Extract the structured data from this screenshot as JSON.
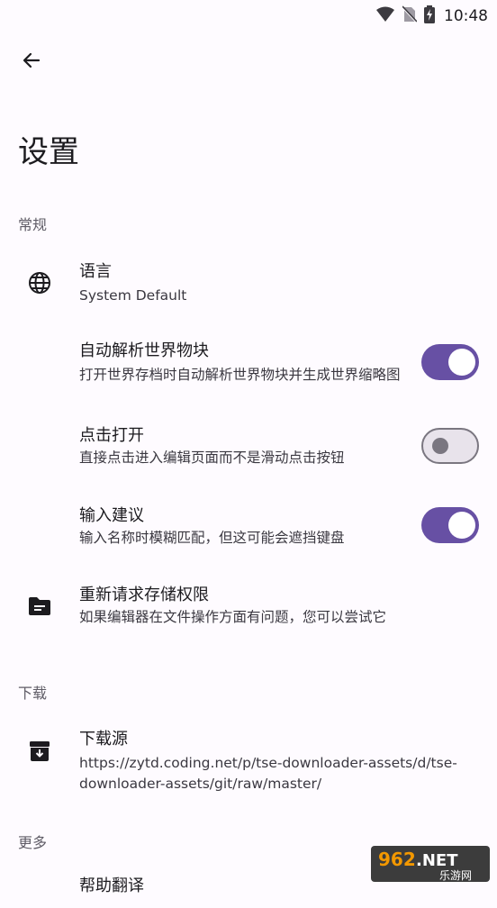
{
  "status_bar": {
    "time": "10:48"
  },
  "page": {
    "title": "设置"
  },
  "sections": {
    "general": "常规",
    "download": "下载",
    "more": "更多"
  },
  "settings": {
    "language": {
      "title": "语言",
      "value": "System Default"
    },
    "auto_parse": {
      "title": "自动解析世界物块",
      "desc": "打开世界存档时自动解析世界物块并生成世界缩略图",
      "enabled": true
    },
    "click_open": {
      "title": "点击打开",
      "desc": "直接点击进入编辑页面而不是滑动点击按钮",
      "enabled": false
    },
    "input_suggest": {
      "title": "输入建议",
      "desc": "输入名称时模糊匹配，但这可能会遮挡键盘",
      "enabled": true
    },
    "storage_perm": {
      "title": "重新请求存储权限",
      "desc": "如果编辑器在文件操作方面有问题，您可以尝试它"
    },
    "download_source": {
      "title": "下载源",
      "value": "https://zytd.coding.net/p/tse-downloader-assets/d/tse-downloader-assets/git/raw/master/"
    },
    "help_translate": {
      "title": "帮助翻译"
    }
  },
  "watermark": {
    "brand": "962.NET",
    "sub": "乐游网"
  },
  "colors": {
    "accent": "#6750a4",
    "background": "#fefbff"
  },
  "icons": [
    "wifi-icon",
    "no-sim-icon",
    "battery-charging-icon",
    "back-arrow-icon",
    "globe-icon",
    "folder-icon",
    "archive-icon"
  ]
}
